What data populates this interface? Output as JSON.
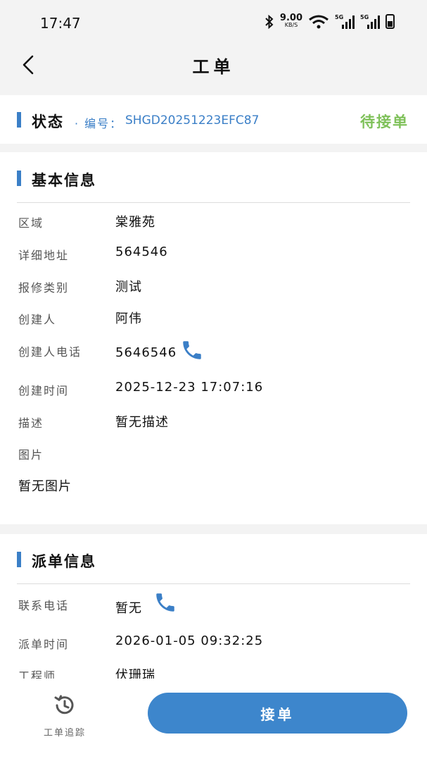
{
  "status_bar": {
    "time": "17:47",
    "net_speed": "9.00",
    "net_unit": "KB/S",
    "sim1_label": "5G",
    "sim2_label": "5G",
    "icons": [
      "bluetooth-icon",
      "wifi-icon",
      "signal-icon",
      "battery-icon"
    ]
  },
  "nav": {
    "title": "工单",
    "back_icon": "chevron-left-icon"
  },
  "status_section": {
    "title": "状态",
    "number_label": "· 编号：",
    "number": "SHGD20251223EFC87",
    "state": "待接单",
    "state_color": "#7fc15a"
  },
  "basic_info": {
    "title": "基本信息",
    "rows": [
      {
        "label": "区域",
        "value": "棠雅苑"
      },
      {
        "label": "详细地址",
        "value": "564546"
      },
      {
        "label": "报修类别",
        "value": "测试"
      },
      {
        "label": "创建人",
        "value": "阿伟"
      },
      {
        "label": "创建人电话",
        "value": "5646546"
      },
      {
        "label": "创建时间",
        "value": "2025-12-23 17:07:16"
      },
      {
        "label": "描述",
        "value": "暂无描述"
      },
      {
        "label": "图片",
        "value": ""
      }
    ],
    "no_image_text": "暂无图片"
  },
  "dispatch_info": {
    "title": "派单信息",
    "rows": [
      {
        "label": "联系电话",
        "value": "暂无"
      },
      {
        "label": "派单时间",
        "value": "2026-01-05 09:32:25"
      },
      {
        "label": "工程师",
        "value": "伏珊瑞"
      }
    ]
  },
  "bottom_bar": {
    "track_label": "工单追踪",
    "accept_label": "接单"
  },
  "colors": {
    "accent": "#3b7fc7",
    "status_pending": "#7fc15a"
  }
}
